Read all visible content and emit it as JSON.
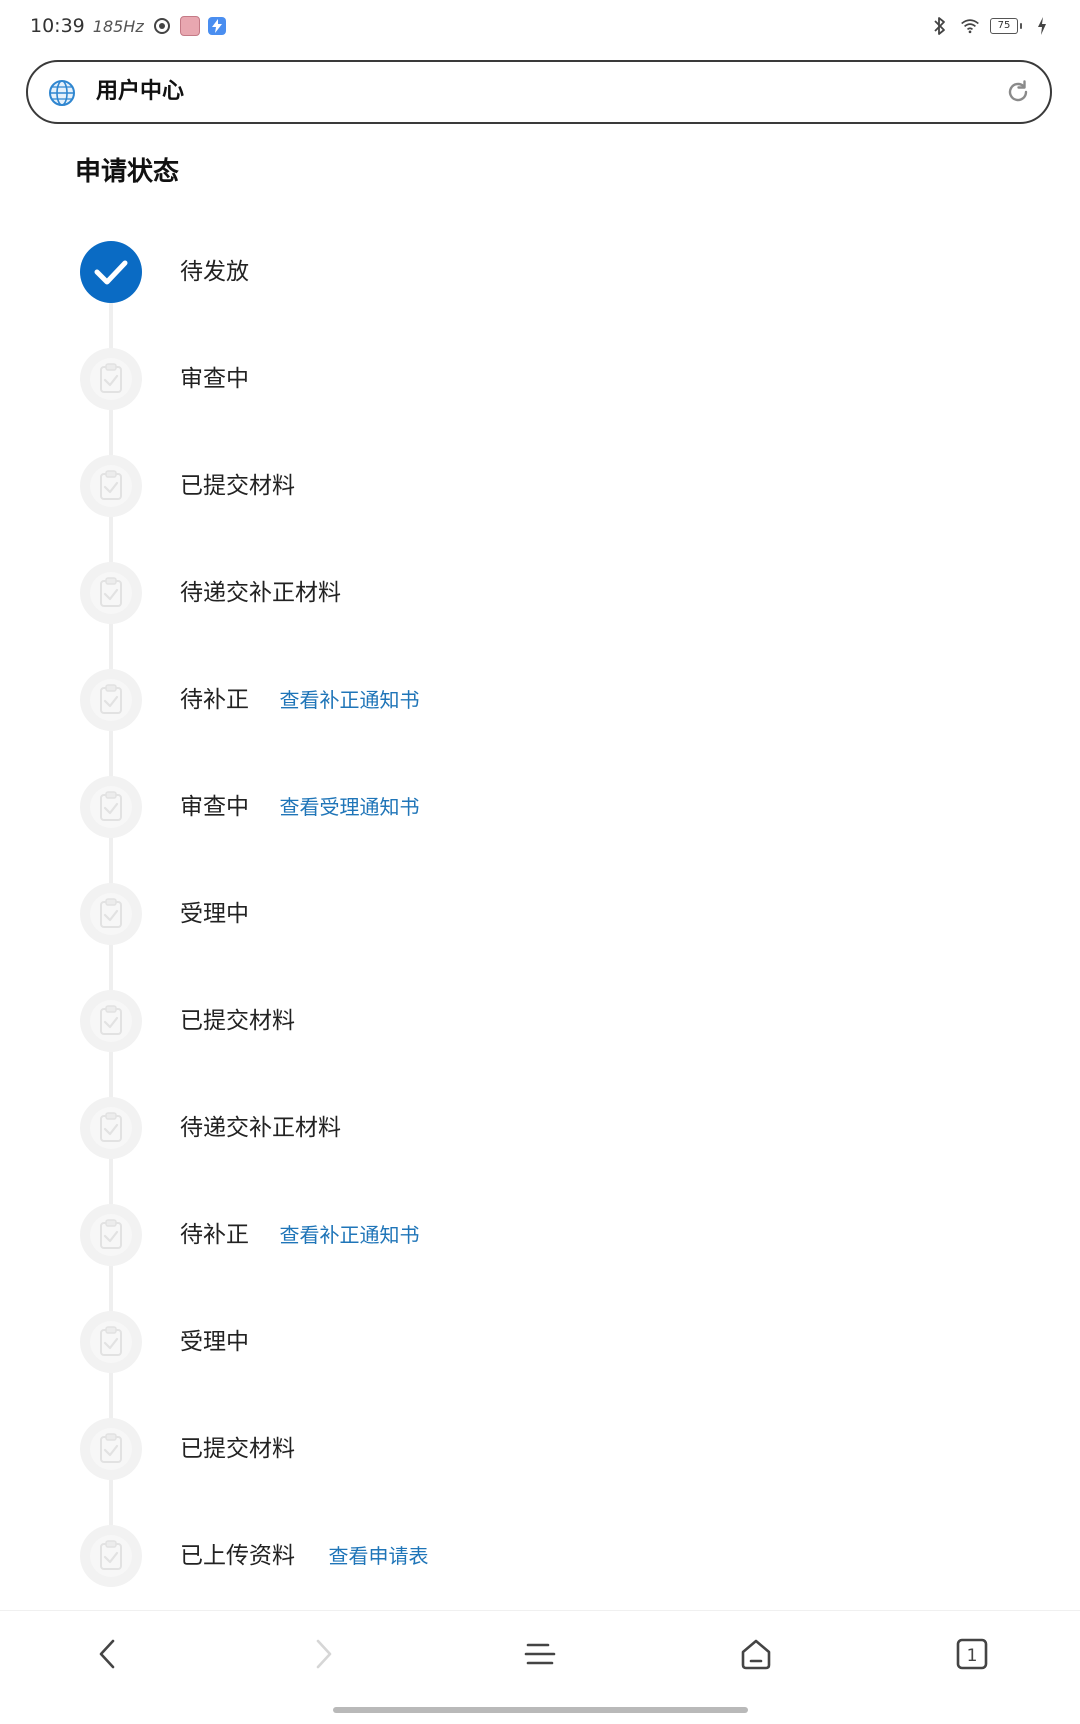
{
  "status_bar": {
    "time": "10:39",
    "refresh_rate": "185Hz",
    "battery": "75"
  },
  "address_bar": {
    "title": "用户中心"
  },
  "page": {
    "title": "申请状态",
    "steps": [
      {
        "label": "待发放",
        "state": "done",
        "link": ""
      },
      {
        "label": "审查中",
        "state": "pending",
        "link": ""
      },
      {
        "label": "已提交材料",
        "state": "pending",
        "link": ""
      },
      {
        "label": "待递交补正材料",
        "state": "pending",
        "link": ""
      },
      {
        "label": "待补正",
        "state": "pending",
        "link": "查看补正通知书"
      },
      {
        "label": "审查中",
        "state": "pending",
        "link": "查看受理通知书"
      },
      {
        "label": "受理中",
        "state": "pending",
        "link": ""
      },
      {
        "label": "已提交材料",
        "state": "pending",
        "link": ""
      },
      {
        "label": "待递交补正材料",
        "state": "pending",
        "link": ""
      },
      {
        "label": "待补正",
        "state": "pending",
        "link": "查看补正通知书"
      },
      {
        "label": "受理中",
        "state": "pending",
        "link": ""
      },
      {
        "label": "已提交材料",
        "state": "pending",
        "link": ""
      },
      {
        "label": "已上传资料",
        "state": "pending",
        "link": "查看申请表"
      }
    ]
  },
  "bottom_nav": {
    "tab_count": "1",
    "icons": [
      "back-icon",
      "forward-icon",
      "menu-icon",
      "home-icon",
      "tabs-icon"
    ]
  },
  "colors": {
    "accent": "#0a6bc4",
    "link": "#1f75b8",
    "pending_marker": "#f2f2f2"
  }
}
